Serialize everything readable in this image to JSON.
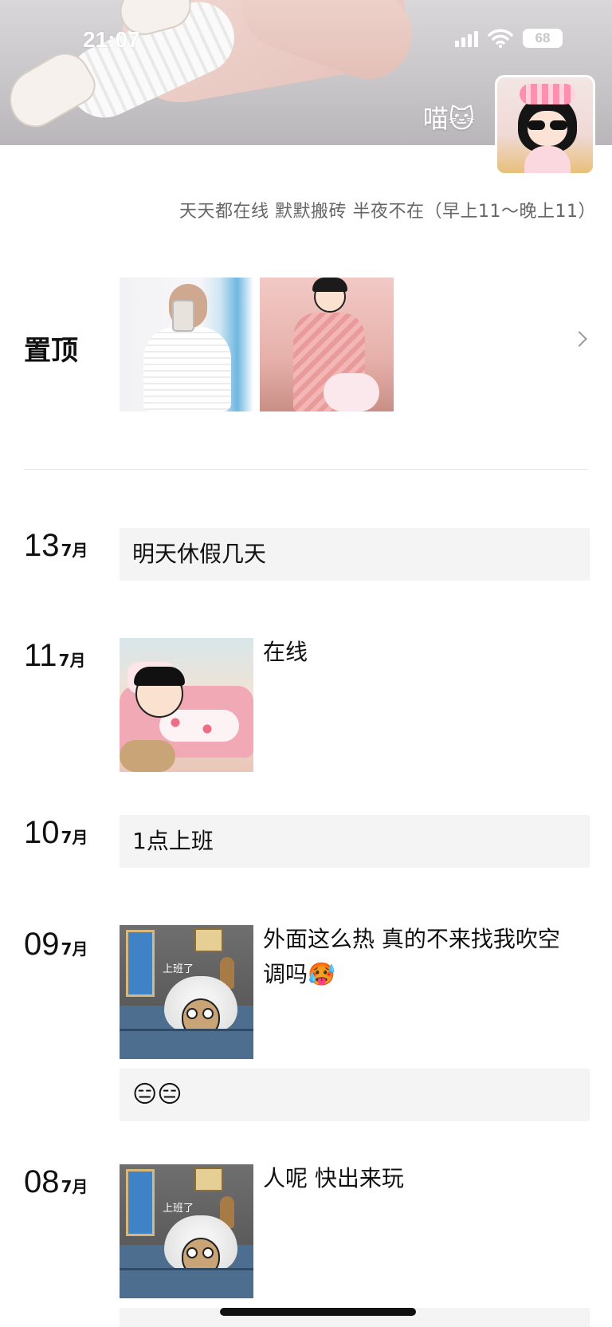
{
  "status_bar": {
    "time": "21:07",
    "battery": "68"
  },
  "profile": {
    "nickname": "喵🐱",
    "signature": "天天都在线 默默搬砖 半夜不在（早上11～晚上11）"
  },
  "pinned": {
    "label": "置顶"
  },
  "posts": [
    {
      "day": "13",
      "month": "7月",
      "text": "明天休假几天"
    },
    {
      "day": "11",
      "month": "7月",
      "text": "在线"
    },
    {
      "day": "10",
      "month": "7月",
      "text": "1点上班"
    },
    {
      "day": "09",
      "month": "7月",
      "text": "外面这么热 真的不来找我吹空调吗🥵",
      "image_caption": "上班了",
      "comment_emojis": "😑😑"
    },
    {
      "day": "08",
      "month": "7月",
      "text": "人呢 快出来玩",
      "image_caption": "上班了"
    }
  ],
  "colors": {
    "card_bg": "#f4f4f4",
    "text": "#111111",
    "subtext": "#666666"
  },
  "icons": [
    "signal-icon",
    "wifi-icon",
    "battery-icon",
    "chevron-right-icon"
  ]
}
